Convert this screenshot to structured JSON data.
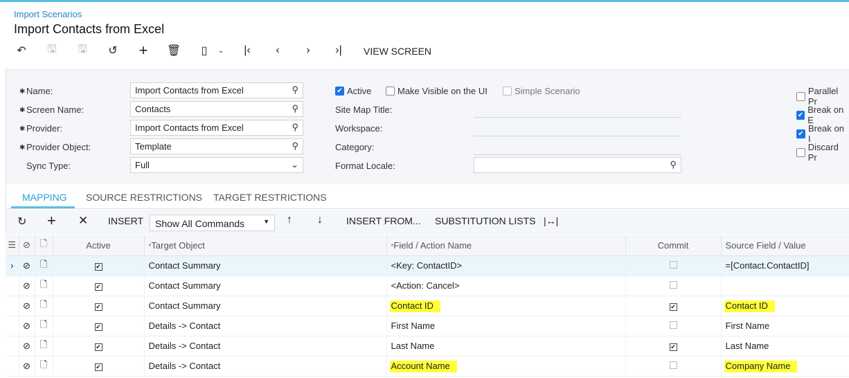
{
  "breadcrumb": "Import Scenarios",
  "title": "Import Contacts from Excel",
  "toolbar": {
    "view_screen": "VIEW SCREEN"
  },
  "form": {
    "name_label": "Name:",
    "name_value": "Import Contacts from Excel",
    "screen_label": "Screen Name:",
    "screen_value": "Contacts",
    "provider_label": "Provider:",
    "provider_value": "Import Contacts from Excel",
    "provider_obj_label": "Provider Object:",
    "provider_obj_value": "Template",
    "sync_label": "Sync Type:",
    "sync_value": "Full",
    "active_label": "Active",
    "visible_label": "Make Visible on the UI",
    "simple_label": "Simple Scenario",
    "sitemap_label": "Site Map Title:",
    "workspace_label": "Workspace:",
    "category_label": "Category:",
    "locale_label": "Format Locale:",
    "parallel_label": "Parallel Pr",
    "break1_label": "Break on E",
    "break2_label": "Break on I",
    "discard_label": "Discard Pr"
  },
  "tabs": [
    "MAPPING",
    "SOURCE RESTRICTIONS",
    "TARGET RESTRICTIONS"
  ],
  "grid_toolbar": {
    "insert": "INSERT",
    "commands": "Show All Commands",
    "insert_from": "INSERT FROM...",
    "subst": "SUBSTITUTION LISTS"
  },
  "columns": [
    "Active",
    "Target Object",
    "Field / Action Name",
    "Commit",
    "Source Field / Value"
  ],
  "rows": [
    {
      "active": true,
      "target": "Contact Summary",
      "field": "<Key: ContactID>",
      "commit": false,
      "source": "=[Contact.ContactID]",
      "hl": false
    },
    {
      "active": true,
      "target": "Contact Summary",
      "field": "<Action: Cancel>",
      "commit": false,
      "source": "",
      "hl": false
    },
    {
      "active": true,
      "target": "Contact Summary",
      "field": "Contact ID",
      "commit": true,
      "source": "Contact ID",
      "hl": true
    },
    {
      "active": true,
      "target": "Details -> Contact",
      "field": "First Name",
      "commit": false,
      "source": "First Name",
      "hl": false
    },
    {
      "active": true,
      "target": "Details -> Contact",
      "field": "Last Name",
      "commit": true,
      "source": "Last Name",
      "hl": false
    },
    {
      "active": true,
      "target": "Details -> Contact",
      "field": "Account Name",
      "commit": false,
      "source": "Company Name",
      "hl": true
    }
  ]
}
